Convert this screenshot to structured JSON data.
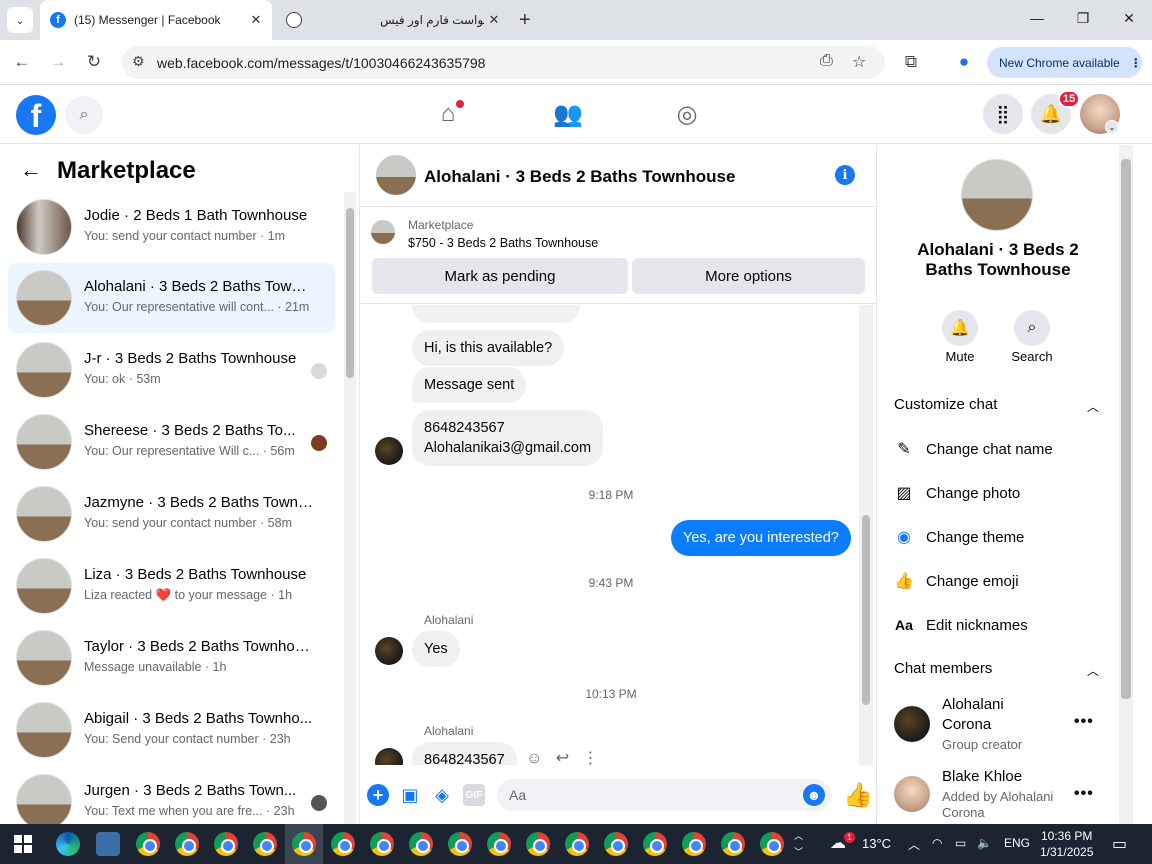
{
  "browser": {
    "tabs": [
      {
        "title": "(15) Messenger | Facebook",
        "active": true
      },
      {
        "title": "درخواست فارم اور فیس",
        "active": false
      }
    ],
    "url": "web.facebook.com/messages/t/10030466243635798",
    "new_chrome_label": "New Chrome available"
  },
  "fbnav": {
    "notification_count": "15"
  },
  "sidebar": {
    "title": "Marketplace",
    "conversations": [
      {
        "name": "Jodie · 2 Beds 1 Bath Townhouse",
        "snippet": "You: send your contact number · 1m",
        "selected": false
      },
      {
        "name": "Alohalani · 3 Beds 2 Baths Townhouse",
        "snippet": "You: Our representative will cont... · 21m",
        "selected": true
      },
      {
        "name": "J-r · 3 Beds 2 Baths Townhouse",
        "snippet": "You: ok · 53m",
        "selected": false
      },
      {
        "name": "Shereese · 3 Beds 2 Baths To...",
        "snippet": "You: Our representative Will c... · 56m",
        "selected": false
      },
      {
        "name": "Jazmyne · 3 Beds 2 Baths Townh...",
        "snippet": "You: send your contact number · 58m",
        "selected": false
      },
      {
        "name": "Liza · 3 Beds 2 Baths Townhouse",
        "snippet": "Liza reacted ❤️ to your message · 1h",
        "selected": false
      },
      {
        "name": "Taylor · 3 Beds 2 Baths Townhou...",
        "snippet": "Message unavailable · 1h",
        "selected": false
      },
      {
        "name": "Abigail · 3 Beds 2 Baths Townho...",
        "snippet": "You: Send your contact number · 23h",
        "selected": false
      },
      {
        "name": "Jurgen · 3 Beds 2 Baths Town...",
        "snippet": "You: Text me when you are fre... · 23h",
        "selected": false
      }
    ]
  },
  "chat": {
    "title": "Alohalani · 3 Beds 2 Baths Townhouse",
    "listing_source": "Marketplace",
    "listing_title": "$750 - 3 Beds 2 Baths Townhouse",
    "mark_pending_label": "Mark as pending",
    "more_options_label": "More options",
    "messages": {
      "m1": "Hi, is this available?",
      "m2": "Message sent",
      "m3_line1": "8648243567",
      "m3_line2": "Alohalanikai3@gmail.com",
      "ts1": "9:18 PM",
      "out1": "Yes, are you interested?",
      "ts2": "9:43 PM",
      "sender1": "Alohalani",
      "m4": "Yes",
      "ts3": "10:13 PM",
      "sender2": "Alohalani",
      "m5": "8648243567"
    },
    "composer_placeholder": "Aa"
  },
  "details": {
    "name": "Alohalani · 3 Beds 2 Baths Townhouse",
    "mute_label": "Mute",
    "search_label": "Search",
    "customize_label": "Customize chat",
    "customize_items": [
      "Change chat name",
      "Change photo",
      "Change theme",
      "Change emoji",
      "Edit nicknames"
    ],
    "members_label": "Chat members",
    "members": [
      {
        "name": "Alohalani Corona",
        "role": "Group creator"
      },
      {
        "name": "Blake Khloe",
        "role": "Added by Alohalani Corona"
      }
    ]
  },
  "taskbar": {
    "temperature": "13°C",
    "language": "ENG",
    "time": "10:36 PM",
    "date": "1/31/2025",
    "weather_badge": "1"
  },
  "colors": {
    "fb_blue": "#1877f2",
    "bubble_out": "#0a7cff",
    "selected_row": "#ebf5ff"
  }
}
